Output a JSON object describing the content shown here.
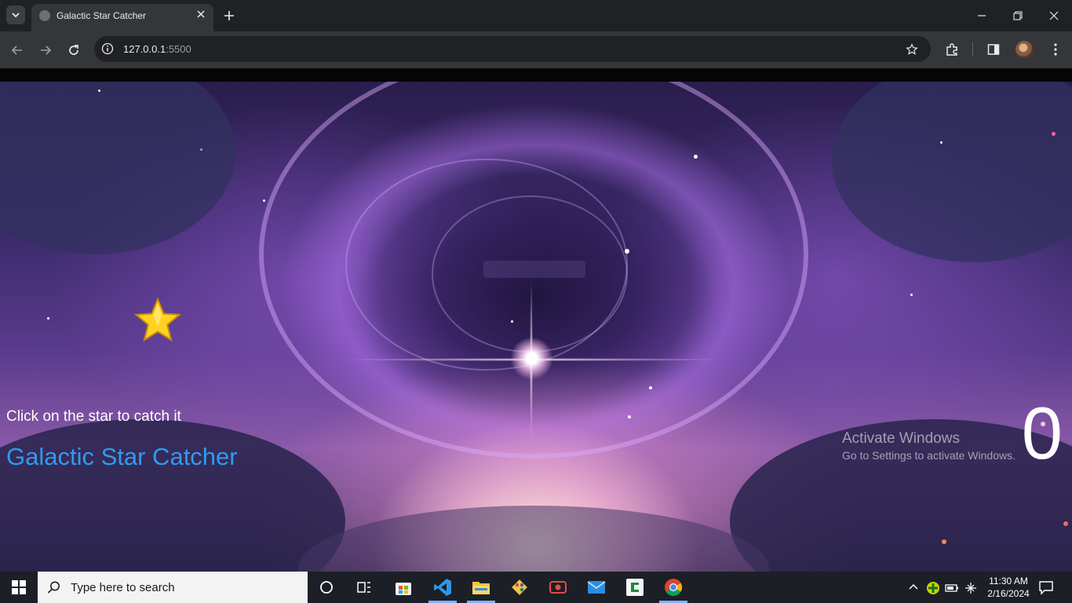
{
  "browser": {
    "tab_title": "Galactic Star Catcher",
    "url_host": "127.0.0.1",
    "url_port": ":5500",
    "icons": [
      "tab-search-icon",
      "favicon-icon",
      "close-icon",
      "plus-icon",
      "minimize-icon",
      "restore-icon",
      "back-icon",
      "forward-icon",
      "reload-icon",
      "site-info-icon",
      "bookmark-star-icon",
      "extensions-icon",
      "side-panel-icon",
      "profile-avatar",
      "kebab-menu-icon"
    ]
  },
  "game": {
    "instruction": "Click on the star to catch it",
    "title": "Galactic Star Catcher",
    "score": "0",
    "colors": {
      "title": "#2e9bf0",
      "star": "#ffd21f",
      "score": "#ffffff"
    }
  },
  "windows_watermark": {
    "title": "Activate Windows",
    "subtitle": "Go to Settings to activate Windows."
  },
  "taskbar": {
    "search_placeholder": "Type here to search",
    "apps": [
      "cortana-icon",
      "task-view-icon",
      "microsoft-store-icon",
      "vscode-icon",
      "file-explorer-icon",
      "git-icon",
      "screen-recorder-icon",
      "mail-icon",
      "camtasia-icon",
      "chrome-icon"
    ],
    "time": "11:30 AM",
    "date": "2/16/2024"
  }
}
